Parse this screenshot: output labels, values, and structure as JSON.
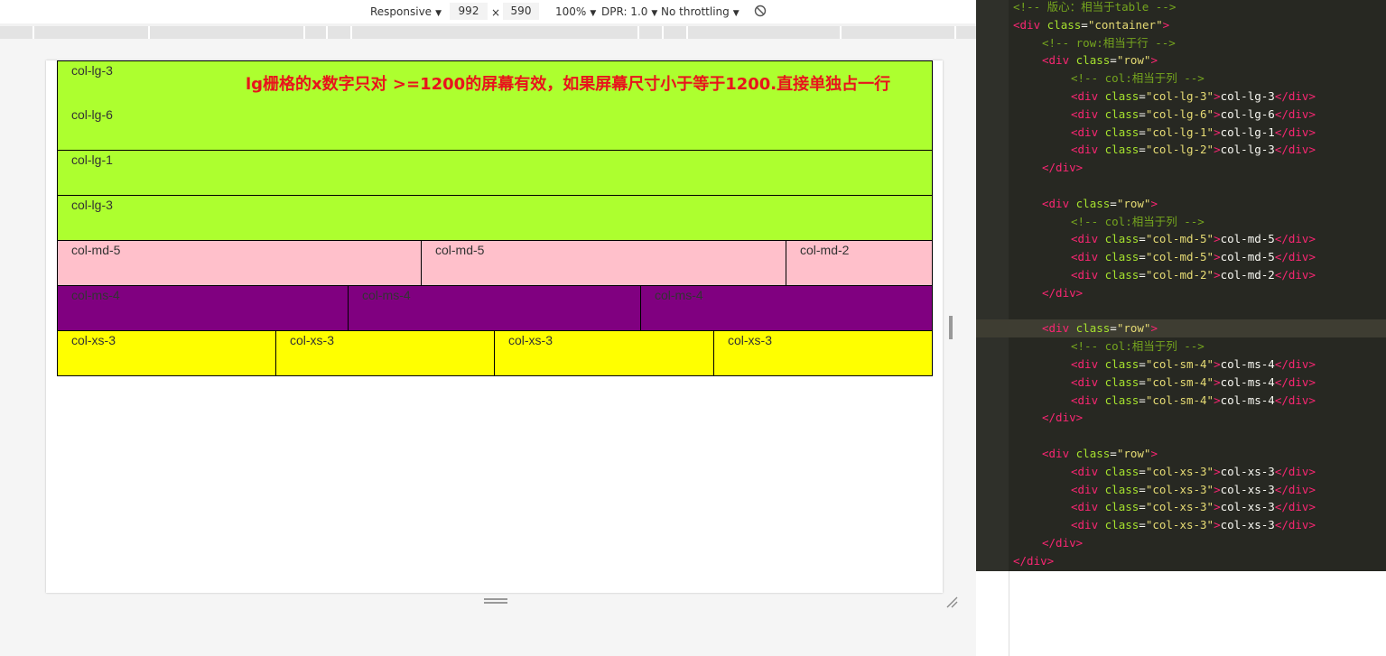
{
  "devtools": {
    "device": "Responsive",
    "width": "992",
    "times": "×",
    "height": "590",
    "zoom": "100%",
    "dpr": "DPR: 1.0",
    "throttle": "No throttling"
  },
  "page": {
    "note": "lg栅格的x数字只对 >=1200的屏幕有效，如果屏幕尺寸小于等于1200.直接单独占一行",
    "rows": [
      {
        "color": "#adff2f",
        "cells": [
          "col-lg-3"
        ]
      },
      {
        "color": "#adff2f",
        "cells": [
          "col-lg-6"
        ]
      },
      {
        "color": "#adff2f",
        "cells": [
          "col-lg-1"
        ]
      },
      {
        "color": "#adff2f",
        "cells": [
          "col-lg-3"
        ]
      },
      {
        "color": "#ffc0cb",
        "cells": [
          "col-md-5",
          "col-md-5",
          "col-md-2"
        ]
      },
      {
        "color": "#800080",
        "cells": [
          "col-ms-4",
          "col-ms-4",
          "col-ms-4"
        ]
      },
      {
        "color": "#ffff00",
        "cells": [
          "col-xs-3",
          "col-xs-3",
          "col-xs-3",
          "col-xs-3"
        ]
      }
    ]
  },
  "editor": {
    "lines": [
      [
        [
          "c-cmt",
          "<!-- 版心：相当于table -->"
        ]
      ],
      [
        [
          "c-tag",
          "<div "
        ],
        [
          "c-attr",
          "class"
        ],
        [
          "c-txt",
          "="
        ],
        [
          "c-str",
          "\"container\""
        ],
        [
          "c-tag",
          ">"
        ]
      ],
      [
        [
          "c-cmt",
          "<!-- row:相当于行 -->"
        ]
      ],
      [
        [
          "c-tag",
          "<div "
        ],
        [
          "c-attr",
          "class"
        ],
        [
          "c-txt",
          "="
        ],
        [
          "c-str",
          "\"row\""
        ],
        [
          "c-tag",
          ">"
        ]
      ],
      [
        [
          "c-cmt",
          "<!-- col:相当于列 -->"
        ]
      ],
      [
        [
          "c-tag",
          "<div "
        ],
        [
          "c-attr",
          "class"
        ],
        [
          "c-txt",
          "="
        ],
        [
          "c-str",
          "\"col-lg-3\""
        ],
        [
          "c-tag",
          ">"
        ],
        [
          "c-txt",
          "col-lg-3"
        ],
        [
          "c-tag",
          "</div>"
        ]
      ],
      [
        [
          "c-tag",
          "<div "
        ],
        [
          "c-attr",
          "class"
        ],
        [
          "c-txt",
          "="
        ],
        [
          "c-str",
          "\"col-lg-6\""
        ],
        [
          "c-tag",
          ">"
        ],
        [
          "c-txt",
          "col-lg-6"
        ],
        [
          "c-tag",
          "</div>"
        ]
      ],
      [
        [
          "c-tag",
          "<div "
        ],
        [
          "c-attr",
          "class"
        ],
        [
          "c-txt",
          "="
        ],
        [
          "c-str",
          "\"col-lg-1\""
        ],
        [
          "c-tag",
          ">"
        ],
        [
          "c-txt",
          "col-lg-1"
        ],
        [
          "c-tag",
          "</div>"
        ]
      ],
      [
        [
          "c-tag",
          "<div "
        ],
        [
          "c-attr",
          "class"
        ],
        [
          "c-txt",
          "="
        ],
        [
          "c-str",
          "\"col-lg-2\""
        ],
        [
          "c-tag",
          ">"
        ],
        [
          "c-txt",
          "col-lg-3"
        ],
        [
          "c-tag",
          "</div>"
        ]
      ],
      [
        [
          "c-tag",
          "</div>"
        ]
      ],
      [],
      [
        [
          "c-tag",
          "<div "
        ],
        [
          "c-attr",
          "class"
        ],
        [
          "c-txt",
          "="
        ],
        [
          "c-str",
          "\"row\""
        ],
        [
          "c-tag",
          ">"
        ]
      ],
      [
        [
          "c-cmt",
          "<!-- col:相当于列 -->"
        ]
      ],
      [
        [
          "c-tag",
          "<div "
        ],
        [
          "c-attr",
          "class"
        ],
        [
          "c-txt",
          "="
        ],
        [
          "c-str",
          "\"col-md-5\""
        ],
        [
          "c-tag",
          ">"
        ],
        [
          "c-txt",
          "col-md-5"
        ],
        [
          "c-tag",
          "</div>"
        ]
      ],
      [
        [
          "c-tag",
          "<div "
        ],
        [
          "c-attr",
          "class"
        ],
        [
          "c-txt",
          "="
        ],
        [
          "c-str",
          "\"col-md-5\""
        ],
        [
          "c-tag",
          ">"
        ],
        [
          "c-txt",
          "col-md-5"
        ],
        [
          "c-tag",
          "</div>"
        ]
      ],
      [
        [
          "c-tag",
          "<div "
        ],
        [
          "c-attr",
          "class"
        ],
        [
          "c-txt",
          "="
        ],
        [
          "c-str",
          "\"col-md-2\""
        ],
        [
          "c-tag",
          ">"
        ],
        [
          "c-txt",
          "col-md-2"
        ],
        [
          "c-tag",
          "</div>"
        ]
      ],
      [
        [
          "c-tag",
          "</div>"
        ]
      ],
      [],
      [
        [
          "c-tag",
          "<div "
        ],
        [
          "c-attr",
          "class"
        ],
        [
          "c-txt",
          "="
        ],
        [
          "c-str",
          "\"row\""
        ],
        [
          "c-tag",
          ">"
        ]
      ],
      [
        [
          "c-cmt",
          "<!-- col:相当于列 -->"
        ]
      ],
      [
        [
          "c-tag",
          "<div "
        ],
        [
          "c-attr",
          "class"
        ],
        [
          "c-txt",
          "="
        ],
        [
          "c-str",
          "\"col-sm-4\""
        ],
        [
          "c-tag",
          ">"
        ],
        [
          "c-txt",
          "col-ms-4"
        ],
        [
          "c-tag",
          "</div>"
        ]
      ],
      [
        [
          "c-tag",
          "<div "
        ],
        [
          "c-attr",
          "class"
        ],
        [
          "c-txt",
          "="
        ],
        [
          "c-str",
          "\"col-sm-4\""
        ],
        [
          "c-tag",
          ">"
        ],
        [
          "c-txt",
          "col-ms-4"
        ],
        [
          "c-tag",
          "</div>"
        ]
      ],
      [
        [
          "c-tag",
          "<div "
        ],
        [
          "c-attr",
          "class"
        ],
        [
          "c-txt",
          "="
        ],
        [
          "c-str",
          "\"col-sm-4\""
        ],
        [
          "c-tag",
          ">"
        ],
        [
          "c-txt",
          "col-ms-4"
        ],
        [
          "c-tag",
          "</div>"
        ]
      ],
      [
        [
          "c-tag",
          "</div>"
        ]
      ],
      [],
      [
        [
          "c-tag",
          "<div "
        ],
        [
          "c-attr",
          "class"
        ],
        [
          "c-txt",
          "="
        ],
        [
          "c-str",
          "\"row\""
        ],
        [
          "c-tag",
          ">"
        ]
      ],
      [
        [
          "c-tag",
          "<div "
        ],
        [
          "c-attr",
          "class"
        ],
        [
          "c-txt",
          "="
        ],
        [
          "c-str",
          "\"col-xs-3\""
        ],
        [
          "c-tag",
          ">"
        ],
        [
          "c-txt",
          "col-xs-3"
        ],
        [
          "c-tag",
          "</div>"
        ]
      ],
      [
        [
          "c-tag",
          "<div "
        ],
        [
          "c-attr",
          "class"
        ],
        [
          "c-txt",
          "="
        ],
        [
          "c-str",
          "\"col-xs-3\""
        ],
        [
          "c-tag",
          ">"
        ],
        [
          "c-txt",
          "col-xs-3"
        ],
        [
          "c-tag",
          "</div>"
        ]
      ],
      [
        [
          "c-tag",
          "<div "
        ],
        [
          "c-attr",
          "class"
        ],
        [
          "c-txt",
          "="
        ],
        [
          "c-str",
          "\"col-xs-3\""
        ],
        [
          "c-tag",
          ">"
        ],
        [
          "c-txt",
          "col-xs-3"
        ],
        [
          "c-tag",
          "</div>"
        ]
      ],
      [
        [
          "c-tag",
          "<div "
        ],
        [
          "c-attr",
          "class"
        ],
        [
          "c-txt",
          "="
        ],
        [
          "c-str",
          "\"col-xs-3\""
        ],
        [
          "c-tag",
          ">"
        ],
        [
          "c-txt",
          "col-xs-3"
        ],
        [
          "c-tag",
          "</div>"
        ]
      ],
      [
        [
          "c-tag",
          "</div>"
        ]
      ],
      [
        [
          "c-tag",
          "</div>"
        ]
      ]
    ]
  }
}
